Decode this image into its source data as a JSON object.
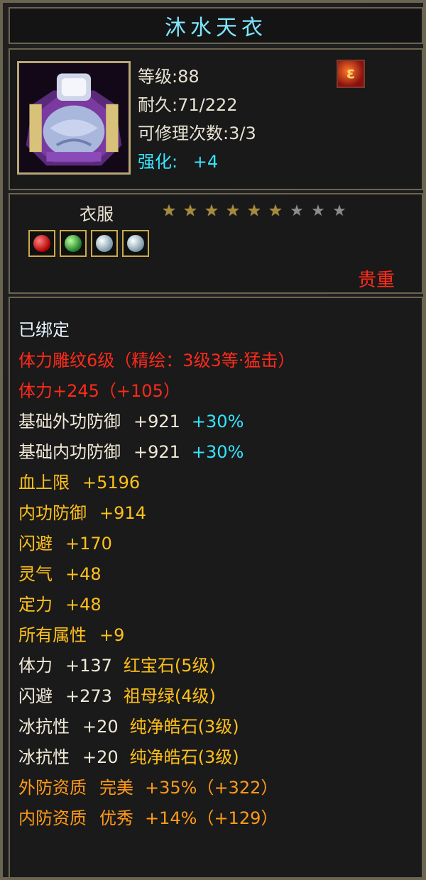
{
  "item": {
    "name": "沐水天衣",
    "level": "等级:88",
    "durability": "耐久:71/222",
    "repair": "可修理次数:3/3",
    "enhance_label": "强化:",
    "enhance_value": "+4",
    "type": "衣服",
    "stars_total": 9,
    "stars_lit": 6,
    "rarity": "贵重",
    "icons": [
      "portrait-armor-icon",
      "skill-flame-icon",
      "red-gem-icon",
      "green-gem-icon",
      "white-gem-icon",
      "white-gem-icon"
    ]
  },
  "stats": [
    {
      "color": "#e8f4ff",
      "parts": [
        "已绑定"
      ]
    },
    {
      "color": "#ff2a1a",
      "parts": [
        "体力雕纹6级（精绘：3级3等·猛击）"
      ]
    },
    {
      "color": "#ff2a1a",
      "parts": [
        "体力+245（+105）"
      ]
    },
    {
      "color": "#f1e9d8",
      "parts": [
        "基础外功防御",
        "+921",
        "+30%"
      ],
      "third_color": "#33e6ff"
    },
    {
      "color": "#f1e9d8",
      "parts": [
        "基础内功防御",
        "+921",
        "+30%"
      ],
      "third_color": "#33e6ff"
    },
    {
      "color": "#ffc01a",
      "parts": [
        "血上限",
        "+5196"
      ]
    },
    {
      "color": "#ffc01a",
      "parts": [
        "内功防御",
        "+914"
      ]
    },
    {
      "color": "#ffc01a",
      "parts": [
        "闪避",
        "+170"
      ]
    },
    {
      "color": "#ffc01a",
      "parts": [
        "灵气",
        "+48"
      ]
    },
    {
      "color": "#ffc01a",
      "parts": [
        "定力",
        "+48"
      ]
    },
    {
      "color": "#ffc01a",
      "parts": [
        "所有属性",
        "+9"
      ]
    },
    {
      "color": "#f1e9d8",
      "parts": [
        "体力",
        "+137",
        "红宝石(5级)"
      ],
      "third_color": "#ffc01a"
    },
    {
      "color": "#f1e9d8",
      "parts": [
        "闪避",
        "+273",
        "祖母绿(4级)"
      ],
      "third_color": "#ffc01a"
    },
    {
      "color": "#f1e9d8",
      "parts": [
        "冰抗性",
        "+20",
        "纯净皓石(3级)"
      ],
      "third_color": "#ffc01a"
    },
    {
      "color": "#f1e9d8",
      "parts": [
        "冰抗性",
        "+20",
        "纯净皓石(3级)"
      ],
      "third_color": "#ffc01a"
    },
    {
      "color": "#ff9a1a",
      "parts": [
        "外防资质",
        "完美",
        "+35%（+322）"
      ]
    },
    {
      "color": "#ff9a1a",
      "parts": [
        "内防资质",
        "优秀",
        "+14%（+129）"
      ]
    }
  ],
  "colors": {
    "frame": "#6b6450",
    "title": "#7fe6ff",
    "cyan": "#33e6ff",
    "red": "#ff2a1a",
    "gold": "#ffc01a"
  }
}
